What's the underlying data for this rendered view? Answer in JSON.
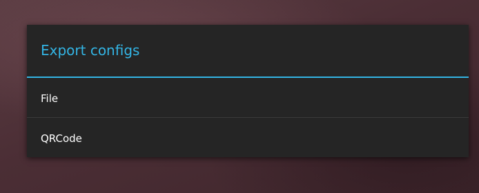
{
  "dialog": {
    "title": "Export configs",
    "accent_color": "#33b5e5",
    "options": [
      {
        "label": "File"
      },
      {
        "label": "QRCode"
      }
    ]
  }
}
